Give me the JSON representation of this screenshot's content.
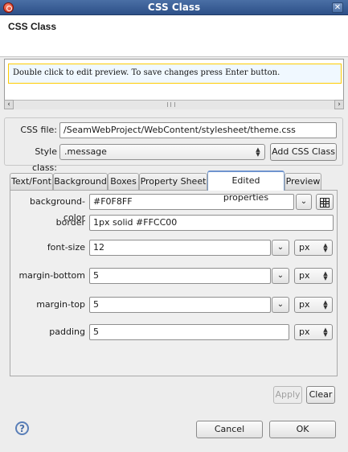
{
  "window": {
    "title": "CSS Class"
  },
  "banner": {
    "title": "CSS Class"
  },
  "preview": {
    "message": "Double click to edit preview. To save changes press Enter button."
  },
  "form": {
    "css_file_label": "CSS file:",
    "css_file_value": "/SeamWebProject/WebContent/stylesheet/theme.css",
    "style_class_label": "Style class:",
    "style_class_value": ".message",
    "add_css_class_label": "Add CSS Class"
  },
  "tabs": [
    "Text/Font",
    "Background",
    "Boxes",
    "Property Sheet",
    "Edited properties",
    "Preview"
  ],
  "active_tab": "Edited properties",
  "properties": [
    {
      "label": "background-color",
      "value": "#F0F8FF"
    },
    {
      "label": "border",
      "value": "1px solid #FFCC00"
    },
    {
      "label": "font-size",
      "value": "12",
      "unit": "px"
    },
    {
      "label": "margin-bottom",
      "value": "5",
      "unit": "px"
    },
    {
      "label": "margin-top",
      "value": "5",
      "unit": "px"
    },
    {
      "label": "padding",
      "value": "5",
      "unit": "px"
    }
  ],
  "actions": {
    "apply": "Apply",
    "clear": "Clear",
    "cancel": "Cancel",
    "ok": "OK"
  },
  "colors": {
    "preview_background": "#F0F8FF",
    "preview_border": "#FFCC00",
    "titlebar": "#3a5d95"
  }
}
